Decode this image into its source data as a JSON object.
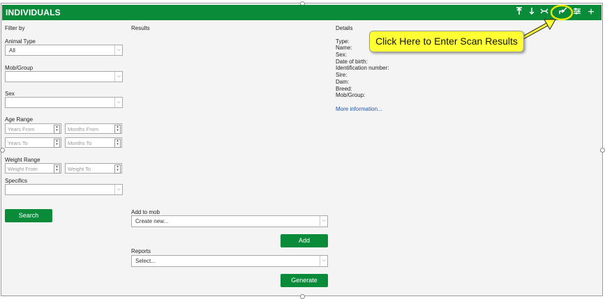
{
  "header": {
    "title": "INDIVIDUALS",
    "icons": [
      "tag-up-icon",
      "sort-down-icon",
      "scan-icon",
      "enter-scan-results-icon",
      "filter-settings-icon",
      "add-icon"
    ]
  },
  "filter": {
    "heading": "Filter by",
    "animal_type_label": "Animal Type",
    "animal_type_value": "All",
    "mob_label": "Mob/Group",
    "mob_value": "",
    "sex_label": "Sex",
    "sex_value": "",
    "age_label": "Age Range",
    "years_from": "Years From",
    "months_from": "Months From",
    "years_to": "Years To",
    "months_to": "Months To",
    "weight_label": "Weight Range",
    "weight_from": "Weight From",
    "weight_to": "Weight To",
    "specifics_label": "Specifics",
    "specifics_value": "",
    "search_button": "Search"
  },
  "results": {
    "heading": "Results",
    "add_to_mob_label": "Add to mob",
    "add_to_mob_value": "Create new...",
    "add_button": "Add",
    "reports_label": "Reports",
    "reports_value": "Select...",
    "generate_button": "Generate"
  },
  "details": {
    "heading": "Details",
    "fields": [
      "Type:",
      "Name:",
      "Sex:",
      "Date of birth:",
      "Identification number:",
      "Sire:",
      "Dam:",
      "Breed:",
      "Mob/Group:"
    ],
    "more_link": "More information..."
  },
  "callout": {
    "text": "Click Here to Enter Scan Results"
  },
  "colors": {
    "header_green": "#0a8b3a",
    "callout_yellow": "#ffff33",
    "highlight_circle": "#e8e800"
  }
}
